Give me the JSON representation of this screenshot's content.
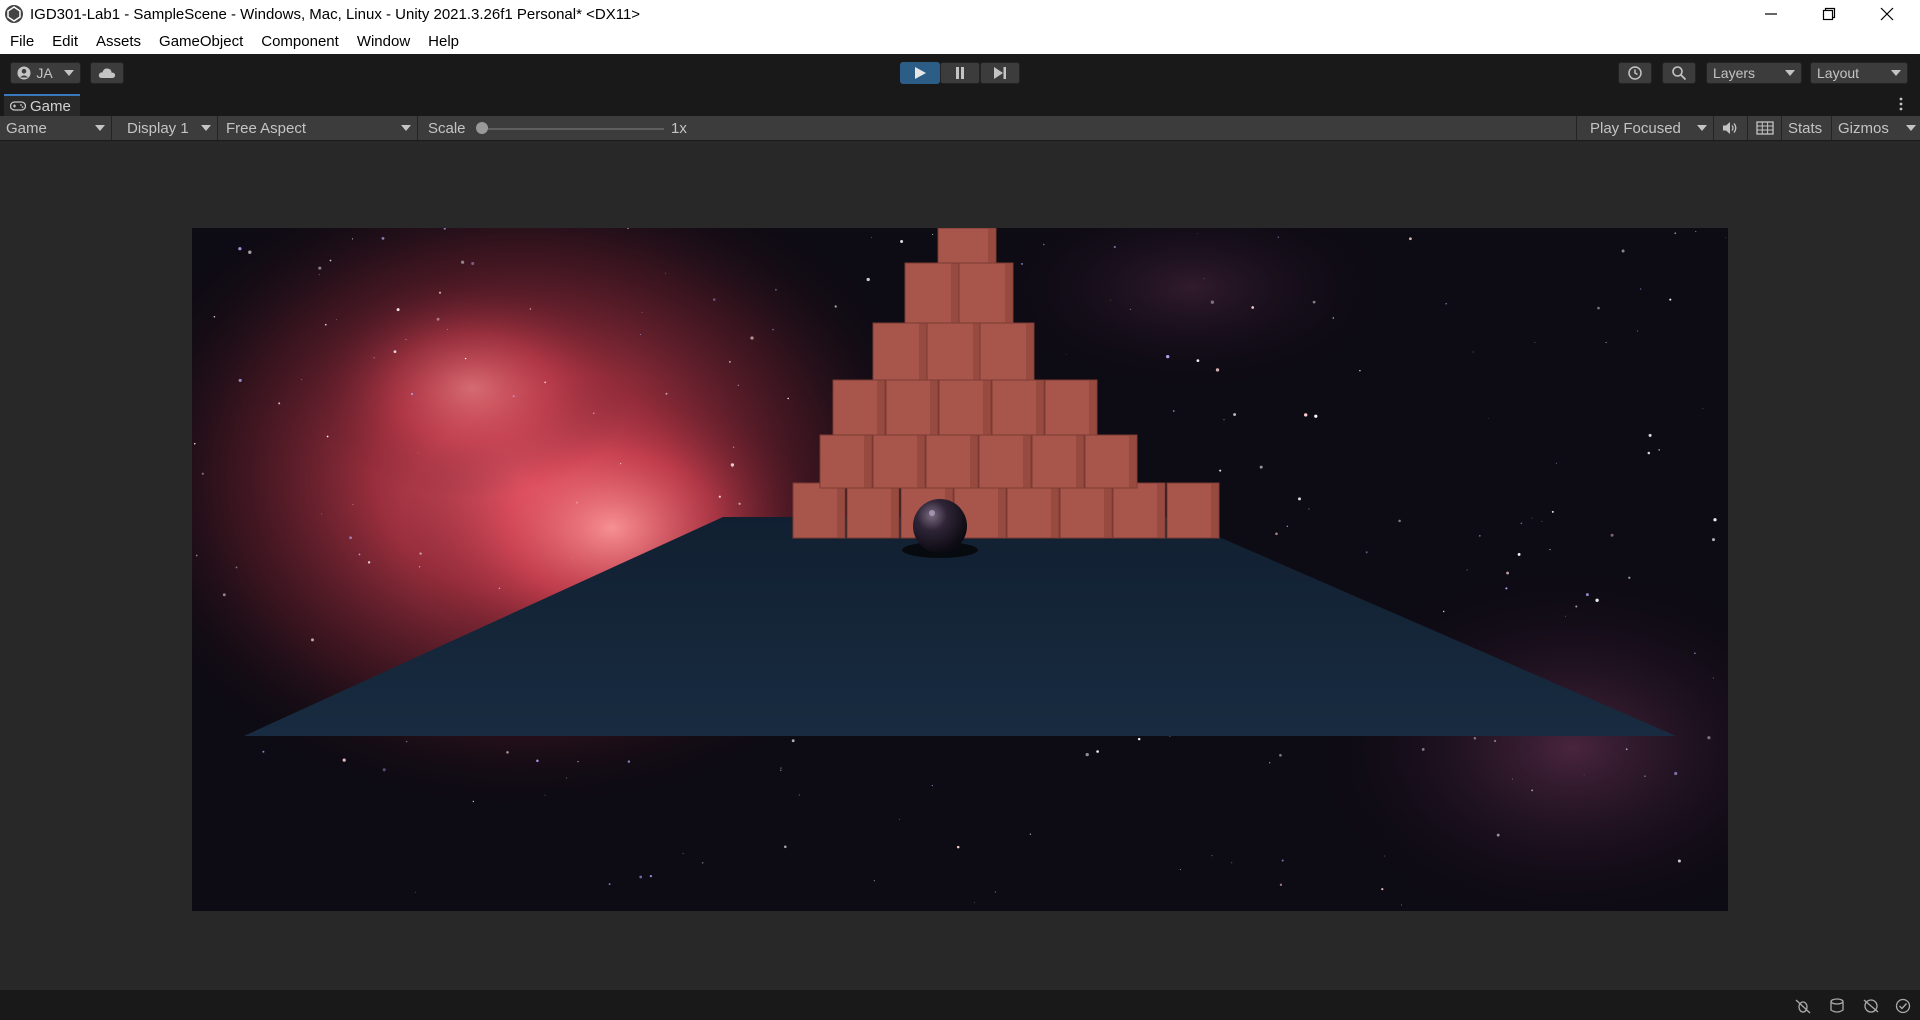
{
  "window": {
    "title": "IGD301-Lab1 - SampleScene - Windows, Mac, Linux - Unity 2021.3.26f1 Personal* <DX11>"
  },
  "menu": [
    "File",
    "Edit",
    "Assets",
    "GameObject",
    "Component",
    "Window",
    "Help"
  ],
  "toolbar": {
    "account_label": "JA",
    "layers_label": "Layers",
    "layout_label": "Layout"
  },
  "game_tab": {
    "label": "Game"
  },
  "game_bar": {
    "view_mode": "Game",
    "display": "Display 1",
    "aspect": "Free Aspect",
    "scale_label": "Scale",
    "scale_value": "1x",
    "play_mode": "Play Focused",
    "stats_label": "Stats",
    "gizmos_label": "Gizmos"
  },
  "colors": {
    "editor_bg": "#282828",
    "toolbar_bg": "#191919",
    "play_active": "#2c5d87",
    "cube": "#a8564b",
    "plane": "#15263a",
    "nebula": "#e0505a"
  },
  "icons": {
    "account": "account-icon",
    "cloud": "cloud-icon",
    "play": "play-icon",
    "pause": "pause-icon",
    "step": "step-icon",
    "history": "history-icon",
    "search": "search-icon",
    "mute": "speaker-icon",
    "aspect_grid": "grid-icon"
  }
}
